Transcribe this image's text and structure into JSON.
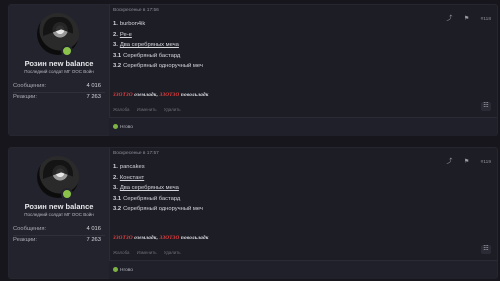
{
  "posts": [
    {
      "author": {
        "name": "Розин new balance",
        "title": "Последний солдат МГ ООС Войн",
        "stats": [
          {
            "label": "Сообщения:",
            "value": "4 016"
          },
          {
            "label": "Реакции:",
            "value": "7 263"
          }
        ]
      },
      "date": "Воскресенье в 17:56",
      "number": "#118",
      "lines": [
        {
          "n": "1.",
          "text": "burbon4ik",
          "underline": false
        },
        {
          "n": "2.",
          "text": "Ре-е",
          "underline": true
        },
        {
          "n": "3.",
          "text": "Два серебряных меча",
          "underline": true
        },
        {
          "n": "3.1",
          "text": "Серебряный бастард",
          "underline": false
        },
        {
          "n": "3.2",
          "text": "Серебряный одноручный меч",
          "underline": false
        }
      ],
      "signature": {
        "r1": "ЗЗОТЗО",
        "w1": "оземладк,",
        "r2": "ЗЗОТЗО",
        "w2": "повольладк"
      },
      "footer": [
        "Жалоба",
        "Изменить",
        "Удалить"
      ],
      "reaction": "Нгово"
    },
    {
      "author": {
        "name": "Розин new balance",
        "title": "Последний солдат МГ ООС Войн",
        "stats": [
          {
            "label": "Сообщения:",
            "value": "4 016"
          },
          {
            "label": "Реакции:",
            "value": "7 263"
          }
        ]
      },
      "date": "Воскресенье в 17:57",
      "number": "#119",
      "lines": [
        {
          "n": "1.",
          "text": "pancakes",
          "underline": false
        },
        {
          "n": "2.",
          "text": "Констант",
          "underline": true
        },
        {
          "n": "3.",
          "text": "Два серебряных меча",
          "underline": true
        },
        {
          "n": "3.1",
          "text": "Серебряный бастард",
          "underline": false
        },
        {
          "n": "3.2",
          "text": "Серебряный одноручный меч",
          "underline": false
        }
      ],
      "signature": {
        "r1": "ЗЗОТЗО",
        "w1": "оземладк,",
        "r2": "ЗЗОТЗО",
        "w2": "повольладк"
      },
      "footer": [
        "Жалоба",
        "Изменить",
        "Удалить"
      ],
      "reaction": "Нгово"
    }
  ],
  "icons": {
    "share": "share-icon",
    "bookmark": "bookmark-icon",
    "quote": "quote-icon",
    "reaction": "reaction-icon"
  },
  "colors": {
    "accent_red": "#e84040",
    "online": "#8bc34a"
  }
}
